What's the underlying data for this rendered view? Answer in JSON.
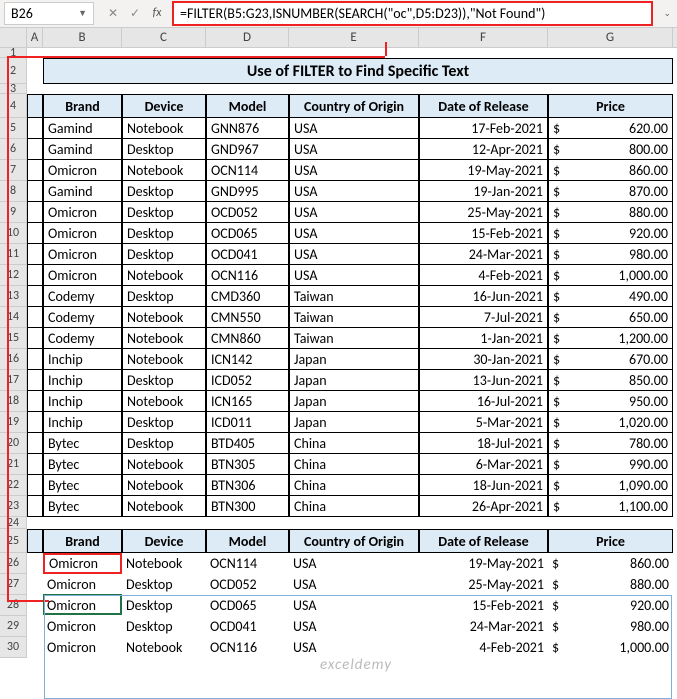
{
  "name_box": "B26",
  "formula": "=FILTER(B5:G23,ISNUMBER(SEARCH(\"oc\",D5:D23)),\"Not Found\")",
  "title": "Use of FILTER to Find Specific Text",
  "cols": [
    "A",
    "B",
    "C",
    "D",
    "E",
    "F",
    "G"
  ],
  "headers": [
    "Brand",
    "Device",
    "Model",
    "Country of Origin",
    "Date of Release",
    "Price"
  ],
  "rows": [
    {
      "n": 5,
      "b": "Gamind",
      "d": "Notebook",
      "m": "GNN876",
      "c": "USA",
      "dt": "17-Feb-2021",
      "p": "620.00"
    },
    {
      "n": 6,
      "b": "Gamind",
      "d": "Desktop",
      "m": "GND967",
      "c": "USA",
      "dt": "12-Apr-2021",
      "p": "800.00"
    },
    {
      "n": 7,
      "b": "Omicron",
      "d": "Notebook",
      "m": "OCN114",
      "c": "USA",
      "dt": "19-May-2021",
      "p": "860.00"
    },
    {
      "n": 8,
      "b": "Gamind",
      "d": "Desktop",
      "m": "GND995",
      "c": "USA",
      "dt": "19-Jan-2021",
      "p": "870.00"
    },
    {
      "n": 9,
      "b": "Omicron",
      "d": "Desktop",
      "m": "OCD052",
      "c": "USA",
      "dt": "25-May-2021",
      "p": "880.00"
    },
    {
      "n": 10,
      "b": "Omicron",
      "d": "Desktop",
      "m": "OCD065",
      "c": "USA",
      "dt": "15-Feb-2021",
      "p": "920.00"
    },
    {
      "n": 11,
      "b": "Omicron",
      "d": "Desktop",
      "m": "OCD041",
      "c": "USA",
      "dt": "24-Mar-2021",
      "p": "980.00"
    },
    {
      "n": 12,
      "b": "Omicron",
      "d": "Notebook",
      "m": "OCN116",
      "c": "USA",
      "dt": "4-Feb-2021",
      "p": "1,000.00"
    },
    {
      "n": 13,
      "b": "Codemy",
      "d": "Desktop",
      "m": "CMD360",
      "c": "Taiwan",
      "dt": "16-Jun-2021",
      "p": "490.00"
    },
    {
      "n": 14,
      "b": "Codemy",
      "d": "Notebook",
      "m": "CMN550",
      "c": "Taiwan",
      "dt": "7-Jul-2021",
      "p": "650.00"
    },
    {
      "n": 15,
      "b": "Codemy",
      "d": "Notebook",
      "m": "CMN860",
      "c": "Taiwan",
      "dt": "1-Jan-2021",
      "p": "1,200.00"
    },
    {
      "n": 16,
      "b": "Inchip",
      "d": "Notebook",
      "m": "ICN142",
      "c": "Japan",
      "dt": "30-Jan-2021",
      "p": "670.00"
    },
    {
      "n": 17,
      "b": "Inchip",
      "d": "Desktop",
      "m": "ICD052",
      "c": "Japan",
      "dt": "13-Jun-2021",
      "p": "850.00"
    },
    {
      "n": 18,
      "b": "Inchip",
      "d": "Notebook",
      "m": "ICN165",
      "c": "Japan",
      "dt": "16-Jul-2021",
      "p": "950.00"
    },
    {
      "n": 19,
      "b": "Inchip",
      "d": "Desktop",
      "m": "ICD011",
      "c": "Japan",
      "dt": "5-Mar-2021",
      "p": "1,020.00"
    },
    {
      "n": 20,
      "b": "Bytec",
      "d": "Desktop",
      "m": "BTD405",
      "c": "China",
      "dt": "18-Jul-2021",
      "p": "780.00"
    },
    {
      "n": 21,
      "b": "Bytec",
      "d": "Notebook",
      "m": "BTN305",
      "c": "China",
      "dt": "6-Mar-2021",
      "p": "990.00"
    },
    {
      "n": 22,
      "b": "Bytec",
      "d": "Notebook",
      "m": "BTN306",
      "c": "China",
      "dt": "18-Jun-2021",
      "p": "1,090.00"
    },
    {
      "n": 23,
      "b": "Bytec",
      "d": "Notebook",
      "m": "BTN300",
      "c": "China",
      "dt": "26-Apr-2021",
      "p": "1,100.00"
    }
  ],
  "filter_rows": [
    {
      "n": 26,
      "b": "Omicron",
      "d": "Notebook",
      "m": "OCN114",
      "c": "USA",
      "dt": "19-May-2021",
      "p": "860.00"
    },
    {
      "n": 27,
      "b": "Omicron",
      "d": "Desktop",
      "m": "OCD052",
      "c": "USA",
      "dt": "25-May-2021",
      "p": "880.00"
    },
    {
      "n": 28,
      "b": "Omicron",
      "d": "Desktop",
      "m": "OCD065",
      "c": "USA",
      "dt": "15-Feb-2021",
      "p": "920.00"
    },
    {
      "n": 29,
      "b": "Omicron",
      "d": "Desktop",
      "m": "OCD041",
      "c": "USA",
      "dt": "24-Mar-2021",
      "p": "980.00"
    },
    {
      "n": 30,
      "b": "Omicron",
      "d": "Notebook",
      "m": "OCN116",
      "c": "USA",
      "dt": "4-Feb-2021",
      "p": "1,000.00"
    }
  ],
  "currency": "$",
  "rownums_pre": [
    1,
    2,
    3,
    4
  ],
  "rownums_gap": [
    24,
    25
  ],
  "watermark": "exceldemy"
}
